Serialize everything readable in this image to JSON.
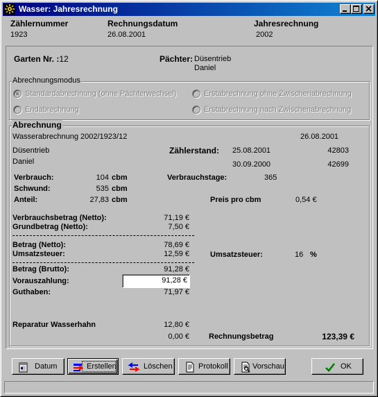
{
  "window": {
    "title": "Wasser: Jahresrechnung"
  },
  "header": {
    "zaehlernummer_label": "Zählernummer",
    "zaehlernummer_value": "1923",
    "rechnungsdatum_label": "Rechnungsdatum",
    "rechnungsdatum_value": "26.08.2001",
    "jahresrechnung_label": "Jahresrechnung",
    "jahresrechnung_value": "2002"
  },
  "garten": {
    "label": "Garten Nr. :",
    "value": "12",
    "paechter_label": "Pächter:",
    "paechter_name1": "Düsentrieb",
    "paechter_name2": "Daniel"
  },
  "abrechnungsmodus": {
    "title": "Abrechnungsmodus",
    "options": [
      {
        "label": "Standardabrechnung (ohne Pächterwechsel)",
        "checked": true
      },
      {
        "label": "Erstabrechnung ohne Zwischenabrechnung",
        "checked": false
      },
      {
        "label": "Endabrechnung",
        "checked": false
      },
      {
        "label": "Erstabrechnung  nach  Zwischenabrechnung",
        "checked": false
      }
    ]
  },
  "abrechnung": {
    "title": "Abrechnung",
    "ref": "Wasserabrechnung 2002/1923/12",
    "date": "26.08.2001",
    "name1": "Düsentrieb",
    "name2": "Daniel",
    "zaehlerstand_label": "Zählerstand:",
    "zaehlerstand": [
      {
        "date": "25.08.2001",
        "value": "42803"
      },
      {
        "date": "30.09.2000",
        "value": "42699"
      }
    ],
    "verbrauch_label": "Verbrauch:",
    "verbrauch_value": "104",
    "schwund_label": "Schwund:",
    "schwund_value": "535",
    "anteil_label": "Anteil:",
    "anteil_value": "27,83",
    "unit_cbm": "cbm",
    "verbrauchstage_label": "Verbrauchstage:",
    "verbrauchstage_value": "365",
    "preis_label": "Preis pro cbm",
    "preis_value": "0,54 €",
    "verbrauchsbetrag_label": "Verbrauchsbetrag (Netto):",
    "verbrauchsbetrag_value": "71,19 €",
    "grundbetrag_label": "Grundbetrag (Netto):",
    "grundbetrag_value": "7,50 €",
    "betrag_netto_label": "Betrag (Netto):",
    "betrag_netto_value": "78,69 €",
    "umsatzsteuer_label": "Umsatzsteuer:",
    "umsatzsteuer_value": "12,59 €",
    "umsatzsteuer_rate_label": "Umsatzsteuer:",
    "umsatzsteuer_rate_value": "16",
    "percent": "%",
    "betrag_brutto_label": "Betrag (Brutto):",
    "betrag_brutto_value": "91,28 €",
    "vorauszahlung_label": "Vorauszahlung:",
    "vorauszahlung_value": "91,28 €",
    "guthaben_label": "Guthaben:",
    "guthaben_value": "71,97 €",
    "reparatur_label": "Reparatur Wasserhahn",
    "reparatur_value": "12,80 €",
    "extra_value": "0,00 €",
    "rechnungsbetrag_label": "Rechnungsbetrag",
    "rechnungsbetrag_value": "123,39 €"
  },
  "toolbar": {
    "datum": "Datum",
    "erstellen": "Erstellen",
    "loeschen": "Löschen",
    "protokoll": "Protokoll",
    "vorschau": "Vorschau",
    "ok": "OK"
  },
  "colors": {
    "titlebar_start": "#000080",
    "titlebar_end": "#1084d0",
    "face": "#c0c0c0"
  },
  "icons": [
    "app-icon",
    "minimize-icon",
    "maximize-icon",
    "close-icon",
    "calendar-icon",
    "create-icon",
    "delete-icon",
    "protocol-icon",
    "preview-icon",
    "checkmark-icon"
  ]
}
